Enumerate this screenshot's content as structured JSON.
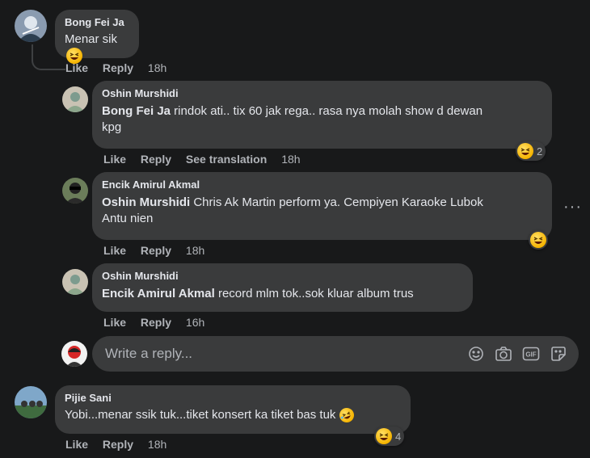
{
  "comments": [
    {
      "author": "Bong Fei Ja",
      "text": "Menar sik",
      "actions": {
        "like": "Like",
        "reply": "Reply",
        "time": "18h"
      }
    },
    {
      "author": "Pijie Sani",
      "text": "Yobi...menar ssik tuk...tiket konsert ka tiket bas tuk",
      "actions": {
        "like": "Like",
        "reply": "Reply",
        "time": "18h"
      },
      "reaction_count": "4"
    }
  ],
  "replies": [
    {
      "author": "Oshin Murshidi",
      "mention": "Bong Fei Ja",
      "text_line1": " rindok ati.. tix 60 jak rega.. rasa nya molah show d dewan",
      "text_line2": "kpg",
      "actions": {
        "like": "Like",
        "reply": "Reply",
        "translate": "See translation",
        "time": "18h"
      },
      "reaction_count": "2"
    },
    {
      "author": "Encik Amirul Akmal",
      "mention": "Oshin Murshidi",
      "text_line1": " Chris Ak Martin perform ya. Cempiyen Karaoke Lubok",
      "text_line2": "Antu nien",
      "actions": {
        "like": "Like",
        "reply": "Reply",
        "time": "18h"
      }
    },
    {
      "author": "Oshin Murshidi",
      "mention": "Encik Amirul Akmal",
      "text_line1": " record mlm tok..sok kluar album trus",
      "actions": {
        "like": "Like",
        "reply": "Reply",
        "time": "16h"
      }
    }
  ],
  "reply_box": {
    "placeholder": "Write a reply..."
  },
  "icons": [
    "emoji-icon",
    "camera-icon",
    "gif-icon",
    "sticker-icon",
    "more-options-icon"
  ],
  "colors": {
    "background": "#18191a",
    "bubble": "#3a3b3c",
    "text": "#e4e6eb",
    "muted": "#b0b3b8"
  }
}
